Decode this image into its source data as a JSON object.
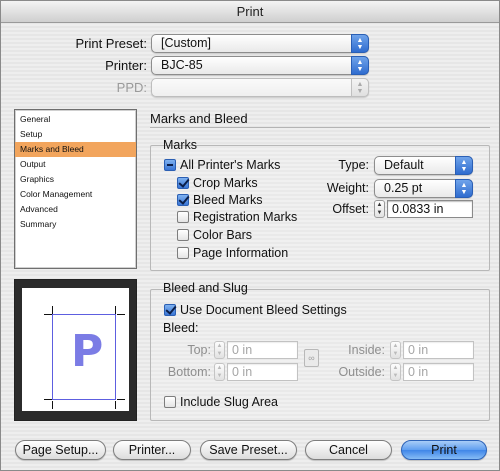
{
  "window": {
    "title": "Print"
  },
  "top": {
    "preset_label": "Print Preset:",
    "preset_value": "[Custom]",
    "printer_label": "Printer:",
    "printer_value": "BJC-85",
    "ppd_label": "PPD:",
    "ppd_value": ""
  },
  "sidebar": {
    "items": [
      {
        "label": "General"
      },
      {
        "label": "Setup"
      },
      {
        "label": "Marks and Bleed",
        "selected": true
      },
      {
        "label": "Output"
      },
      {
        "label": "Graphics"
      },
      {
        "label": "Color Management"
      },
      {
        "label": "Advanced"
      },
      {
        "label": "Summary"
      }
    ]
  },
  "section": {
    "title": "Marks and Bleed"
  },
  "marks": {
    "title": "Marks",
    "all_printers_marks": {
      "label": "All Printer's Marks",
      "state": "mixed"
    },
    "crop_marks": {
      "label": "Crop Marks",
      "checked": true
    },
    "bleed_marks": {
      "label": "Bleed Marks",
      "checked": true
    },
    "registration_marks": {
      "label": "Registration Marks",
      "checked": false
    },
    "color_bars": {
      "label": "Color Bars",
      "checked": false
    },
    "page_information": {
      "label": "Page Information",
      "checked": false
    },
    "type_label": "Type:",
    "type_value": "Default",
    "weight_label": "Weight:",
    "weight_value": "0.25 pt",
    "offset_label": "Offset:",
    "offset_value": "0.0833 in"
  },
  "bleed": {
    "title": "Bleed and Slug",
    "use_document": {
      "label": "Use Document Bleed Settings",
      "checked": true
    },
    "bleed_label": "Bleed:",
    "top_label": "Top:",
    "top_value": "0 in",
    "bottom_label": "Bottom:",
    "bottom_value": "0 in",
    "inside_label": "Inside:",
    "inside_value": "0 in",
    "outside_label": "Outside:",
    "outside_value": "0 in",
    "include_slug": {
      "label": "Include Slug Area",
      "checked": false
    }
  },
  "preview": {
    "letter": "P"
  },
  "buttons": {
    "page_setup": "Page Setup...",
    "printer": "Printer...",
    "save_preset": "Save Preset...",
    "cancel": "Cancel",
    "print": "Print"
  },
  "colors": {
    "selection": "#f2a55d",
    "accent_blue": "#3f86e8",
    "preview_mark": "#7b7ce5"
  }
}
